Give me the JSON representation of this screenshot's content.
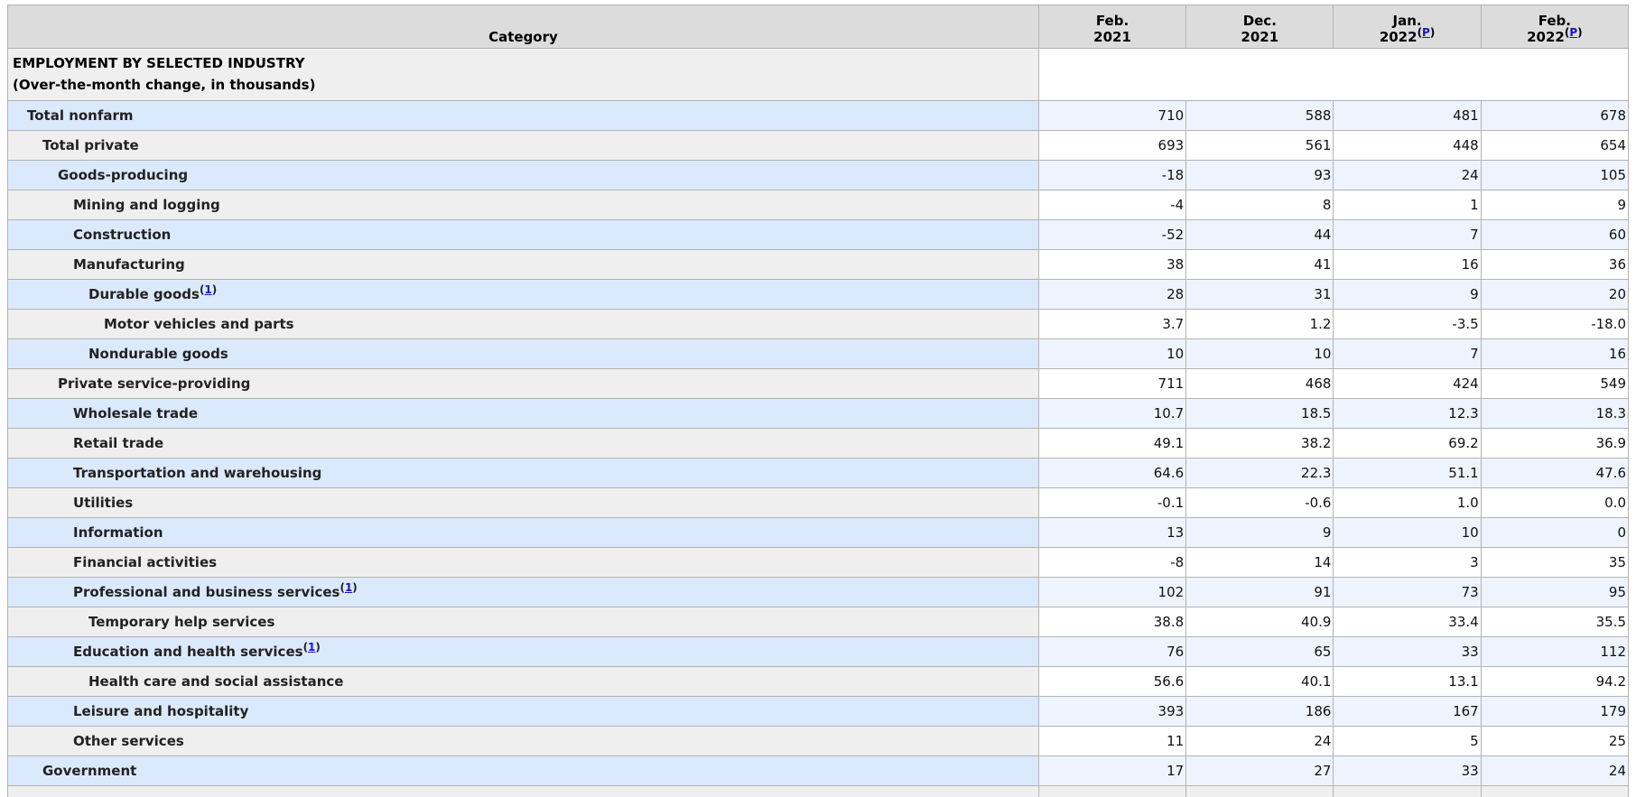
{
  "colors": {
    "header_bg": "#dcdcdc",
    "row_label_blue": "#dbe9fc",
    "row_num_blue": "#eef4fd",
    "row_label_gray": "#efefef",
    "footnote_link": "#1515c8",
    "cut_title": "#b22222"
  },
  "table": {
    "headers": {
      "category": "Category",
      "cols": [
        {
          "line1": "Feb.",
          "line2": "2021",
          "footnote": ""
        },
        {
          "line1": "Dec.",
          "line2": "2021",
          "footnote": ""
        },
        {
          "line1": "Jan.",
          "line2": "2022",
          "footnote": "P"
        },
        {
          "line1": "Feb.",
          "line2": "2022",
          "footnote": "P"
        }
      ]
    },
    "section": {
      "line1": "EMPLOYMENT BY SELECTED INDUSTRY",
      "line2": "(Over-the-month change, in thousands)"
    },
    "rows": [
      {
        "label": "Total nonfarm",
        "indent": 1,
        "footnote": "",
        "values": [
          "710",
          "588",
          "481",
          "678"
        ]
      },
      {
        "label": "Total private",
        "indent": 2,
        "footnote": "",
        "values": [
          "693",
          "561",
          "448",
          "654"
        ]
      },
      {
        "label": "Goods-producing",
        "indent": 3,
        "footnote": "",
        "values": [
          "-18",
          "93",
          "24",
          "105"
        ]
      },
      {
        "label": "Mining and logging",
        "indent": 4,
        "footnote": "",
        "values": [
          "-4",
          "8",
          "1",
          "9"
        ]
      },
      {
        "label": "Construction",
        "indent": 4,
        "footnote": "",
        "values": [
          "-52",
          "44",
          "7",
          "60"
        ]
      },
      {
        "label": "Manufacturing",
        "indent": 4,
        "footnote": "",
        "values": [
          "38",
          "41",
          "16",
          "36"
        ]
      },
      {
        "label": "Durable goods",
        "indent": 5,
        "footnote": "1",
        "values": [
          "28",
          "31",
          "9",
          "20"
        ]
      },
      {
        "label": "Motor vehicles and parts",
        "indent": 6,
        "footnote": "",
        "values": [
          "3.7",
          "1.2",
          "-3.5",
          "-18.0"
        ]
      },
      {
        "label": "Nondurable goods",
        "indent": 5,
        "footnote": "",
        "values": [
          "10",
          "10",
          "7",
          "16"
        ]
      },
      {
        "label": "Private service-providing",
        "indent": 3,
        "footnote": "",
        "values": [
          "711",
          "468",
          "424",
          "549"
        ]
      },
      {
        "label": "Wholesale trade",
        "indent": 4,
        "footnote": "",
        "values": [
          "10.7",
          "18.5",
          "12.3",
          "18.3"
        ]
      },
      {
        "label": "Retail trade",
        "indent": 4,
        "footnote": "",
        "values": [
          "49.1",
          "38.2",
          "69.2",
          "36.9"
        ]
      },
      {
        "label": "Transportation and warehousing",
        "indent": 4,
        "footnote": "",
        "values": [
          "64.6",
          "22.3",
          "51.1",
          "47.6"
        ]
      },
      {
        "label": "Utilities",
        "indent": 4,
        "footnote": "",
        "values": [
          "-0.1",
          "-0.6",
          "1.0",
          "0.0"
        ]
      },
      {
        "label": "Information",
        "indent": 4,
        "footnote": "",
        "values": [
          "13",
          "9",
          "10",
          "0"
        ]
      },
      {
        "label": "Financial activities",
        "indent": 4,
        "footnote": "",
        "values": [
          "-8",
          "14",
          "3",
          "35"
        ]
      },
      {
        "label": "Professional and business services",
        "indent": 4,
        "footnote": "1",
        "values": [
          "102",
          "91",
          "73",
          "95"
        ]
      },
      {
        "label": "Temporary help services",
        "indent": 5,
        "footnote": "",
        "values": [
          "38.8",
          "40.9",
          "33.4",
          "35.5"
        ]
      },
      {
        "label": "Education and health services",
        "indent": 4,
        "footnote": "1",
        "values": [
          "76",
          "65",
          "33",
          "112"
        ]
      },
      {
        "label": "Health care and social assistance",
        "indent": 5,
        "footnote": "",
        "values": [
          "56.6",
          "40.1",
          "13.1",
          "94.2"
        ]
      },
      {
        "label": "Leisure and hospitality",
        "indent": 4,
        "footnote": "",
        "values": [
          "393",
          "186",
          "167",
          "179"
        ]
      },
      {
        "label": "Other services",
        "indent": 4,
        "footnote": "",
        "values": [
          "11",
          "24",
          "5",
          "25"
        ]
      },
      {
        "label": "Government",
        "indent": 2,
        "footnote": "",
        "values": [
          "17",
          "27",
          "33",
          "24"
        ]
      }
    ]
  }
}
